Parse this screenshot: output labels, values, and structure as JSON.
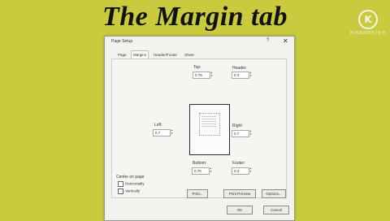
{
  "heading": "The Margin tab",
  "watermark": {
    "icon": "K",
    "text": "KINEMASTER"
  },
  "dialog": {
    "title": "Page Setup",
    "help_glyph": "?",
    "close_glyph": "✕",
    "tabs": [
      "Page",
      "Margins",
      "Header/Footer",
      "Sheet"
    ],
    "active_tab": "Margins",
    "fields": {
      "top": {
        "label": "Top:",
        "value": "0.75"
      },
      "header": {
        "label": "Header:",
        "value": "0.3"
      },
      "left": {
        "label": "Left:",
        "value": "0.7"
      },
      "right": {
        "label": "Right:",
        "value": "0.7"
      },
      "bottom": {
        "label": "Bottom:",
        "value": "0.75"
      },
      "footer": {
        "label": "Footer:",
        "value": "0.3"
      }
    },
    "center_on_page": {
      "label": "Center on page",
      "horizontally": "Horizontally",
      "vertically": "Vertically"
    },
    "buttons": {
      "print": "Print...",
      "print_preview": "Print Preview",
      "options": "Options...",
      "ok": "OK",
      "cancel": "Cancel"
    }
  }
}
